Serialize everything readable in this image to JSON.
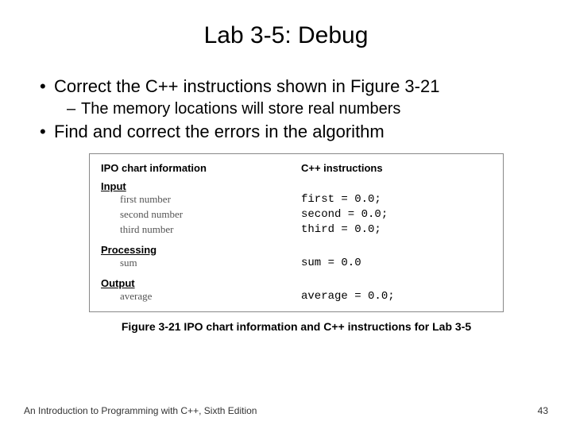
{
  "title": "Lab 3-5: Debug",
  "bullets": {
    "b1a": "Correct the C++ instructions shown in Figure 3-21",
    "b2a": "The memory locations will store real numbers",
    "b1b": "Find and correct the errors in the algorithm"
  },
  "figure": {
    "hdr_left": "IPO chart information",
    "hdr_right": "C++ instructions",
    "sec_input": "Input",
    "sec_processing": "Processing",
    "sec_output": "Output",
    "rows": {
      "r1L": "first number",
      "r1R": "first = 0.0;",
      "r2L": "second number",
      "r2R": "second = 0.0;",
      "r3L": "third number",
      "r3R": "third = 0.0;",
      "r4L": "sum",
      "r4R": "sum = 0.0",
      "r5L": "average",
      "r5R": "average = 0.0;"
    },
    "caption": "Figure 3-21 IPO chart information and C++ instructions for Lab 3-5"
  },
  "footer": {
    "left": "An Introduction to Programming with C++, Sixth Edition",
    "right": "43"
  }
}
